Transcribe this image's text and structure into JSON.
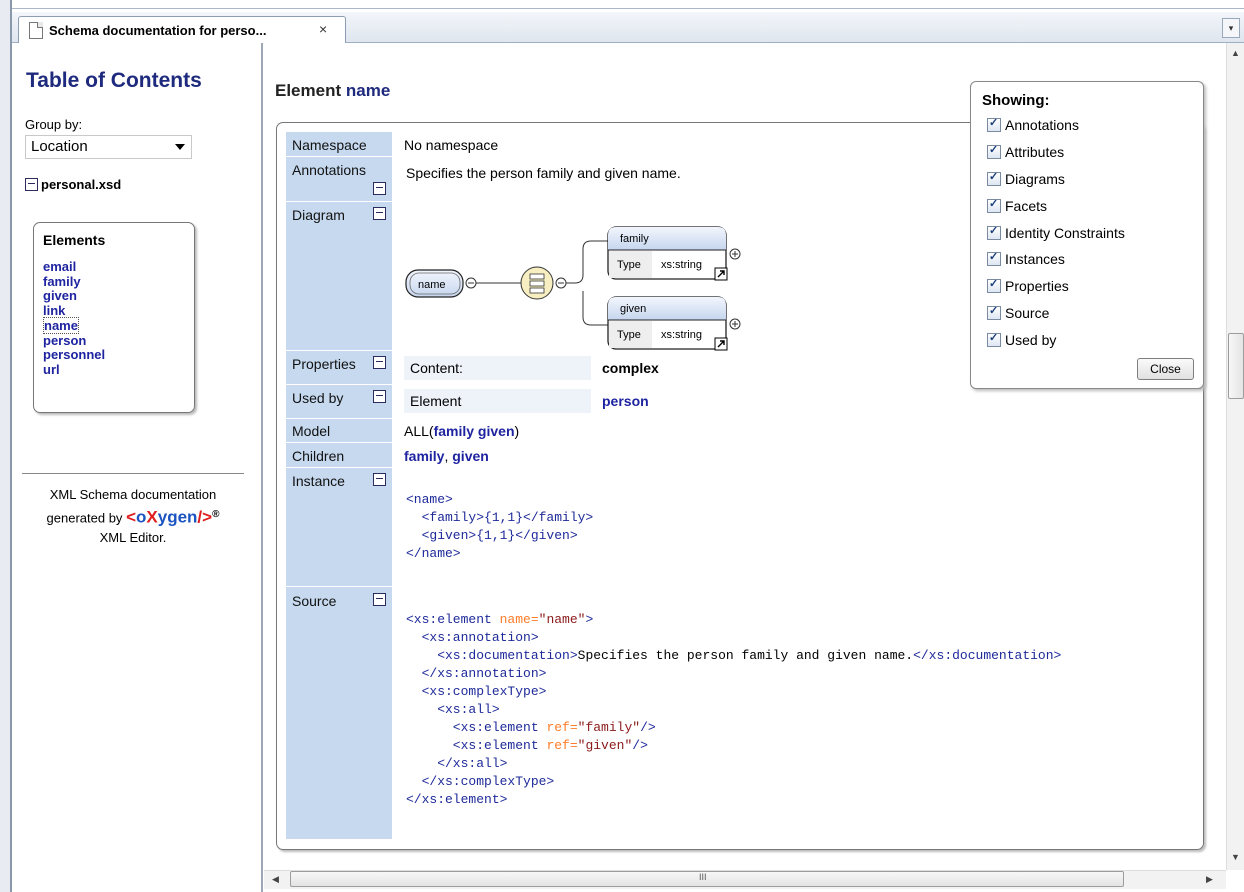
{
  "tab": {
    "title": "Schema documentation for perso...",
    "close": "×",
    "menu": "▾"
  },
  "toc": {
    "title": "Table of Contents",
    "group_by_label": "Group by:",
    "group_by_value": "Location",
    "file": "personal.xsd",
    "elements_title": "Elements",
    "elements": [
      "email",
      "family",
      "given",
      "link",
      "name",
      "person",
      "personnel",
      "url"
    ],
    "selected": "name"
  },
  "footer": {
    "line1": "XML Schema documentation",
    "line2": "generated by",
    "logo_l": "<",
    "logo_o": "o",
    "logo_x": "X",
    "logo_ygen": "ygen",
    "logo_r": "/>",
    "reg": "®",
    "line3": "XML Editor."
  },
  "element": {
    "heading_prefix": "Element",
    "heading_name": "name",
    "labels": {
      "namespace": "Namespace",
      "annotations": "Annotations",
      "diagram": "Diagram",
      "properties": "Properties",
      "used_by": "Used by",
      "model": "Model",
      "children": "Children",
      "instance": "Instance",
      "source": "Source"
    },
    "namespace": "No namespace",
    "annotation": "Specifies the person family and given name.",
    "diagram": {
      "root": "name",
      "child1": "family",
      "child2": "given",
      "type_label": "Type",
      "type_value": "xs:string"
    },
    "properties": {
      "key": "Content:",
      "value": "complex"
    },
    "used_by": {
      "key": "Element",
      "value": "person"
    },
    "model_prefix": "ALL(",
    "model_items": "family given",
    "model_suffix": ")",
    "children": {
      "first": "family",
      "sep": ", ",
      "second": "given"
    },
    "instance_lines": [
      "<name>",
      "  <family>{1,1}</family>",
      "  <given>{1,1}</given>",
      "</name>"
    ],
    "source": {
      "l1_open": "<xs:element ",
      "l1_attr": "name=",
      "l1_val": "\"name\"",
      "l1_close": ">",
      "l2": "  <xs:annotation>",
      "l3_open": "    <xs:documentation>",
      "l3_text": "Specifies the person family and given name.",
      "l3_close": "</xs:documentation>",
      "l4": "  </xs:annotation>",
      "l5": "  <xs:complexType>",
      "l6": "    <xs:all>",
      "l7_open": "      <xs:element ",
      "l7_attr": "ref=",
      "l7_val": "\"family\"",
      "l7_close": "/>",
      "l8_open": "      <xs:element ",
      "l8_attr": "ref=",
      "l8_val": "\"given\"",
      "l8_close": "/>",
      "l9": "    </xs:all>",
      "l10": "  </xs:complexType>",
      "l11": "</xs:element>"
    }
  },
  "showing": {
    "title": "Showing:",
    "options": [
      "Annotations",
      "Attributes",
      "Diagrams",
      "Facets",
      "Identity Constraints",
      "Instances",
      "Properties",
      "Source",
      "Used by"
    ],
    "checked": [
      true,
      true,
      true,
      true,
      true,
      true,
      true,
      true,
      true
    ],
    "close_label": "Close"
  },
  "scroll": {
    "h_grip": "III"
  },
  "colors": {
    "label_bg": "#c6d9ef",
    "link": "#1e23a0",
    "toc_title": "#1e2a7d",
    "tag": "#1e2a9a",
    "attr": "#ff7c29"
  }
}
